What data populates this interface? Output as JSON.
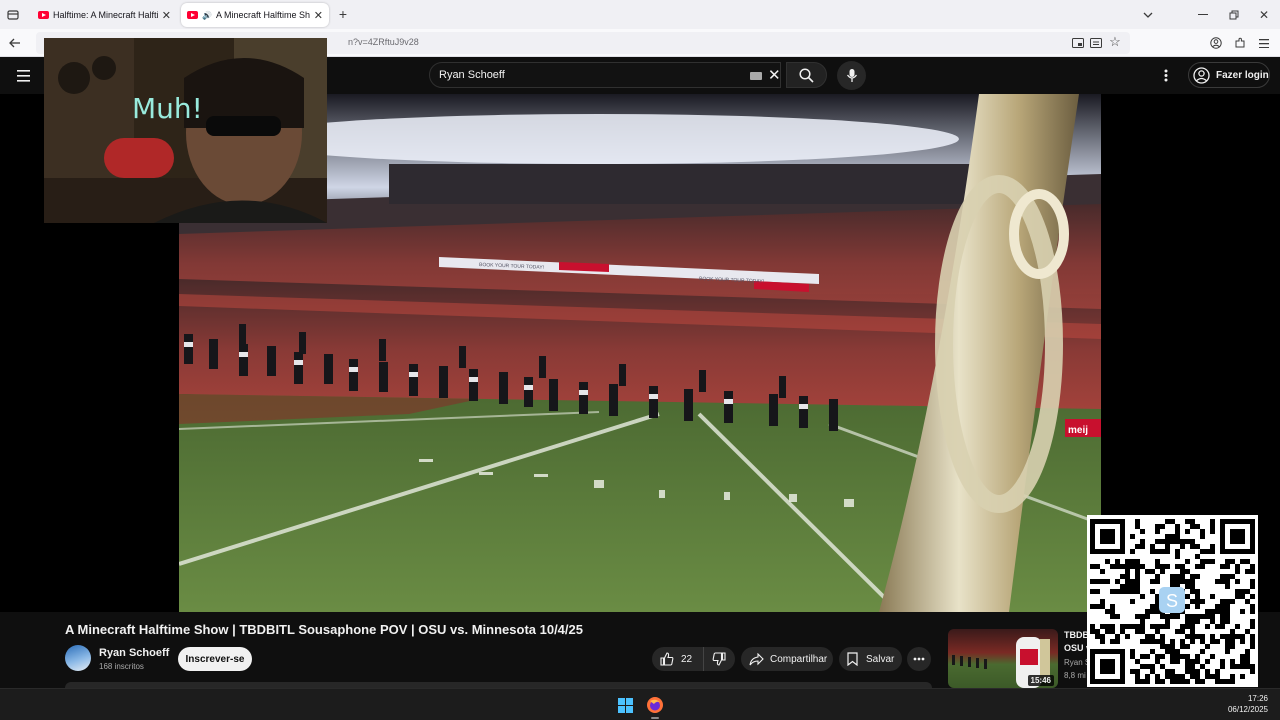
{
  "browser": {
    "tabs": [
      {
        "title": "Halftime: A Minecraft Halftime S",
        "active": false
      },
      {
        "title": "A Minecraft Halftime Show",
        "active": true
      }
    ],
    "url": "n?v=4ZRftuJ9v28"
  },
  "header": {
    "search_query": "Ryan Schoeff",
    "login_label": "Fazer login"
  },
  "video": {
    "title": "A Minecraft Halftime Show | TBDBITL Sousaphone POV | OSU vs. Minnesota 10/4/25",
    "webcam_sign": "Muh!",
    "banner_text_1": "BOOK YOUR TOUR TODAY!",
    "banner_text_2": "BOOK YOUR TOUR TODAY!",
    "ad_corner": "meij"
  },
  "channel": {
    "name": "Ryan Schoeff",
    "subscribers": "168 inscritos",
    "subscribe_label": "Inscrever-se"
  },
  "actions": {
    "likes": "22",
    "share_label": "Compartilhar",
    "save_label": "Salvar"
  },
  "recommendation": {
    "title": "TBDB",
    "title_line2": "OSU v",
    "channel": "Ryan S",
    "meta": "8,8 mi",
    "duration": "15:46"
  },
  "taskbar": {
    "time": "17:26",
    "date": "06/12/2025"
  },
  "colors": {
    "youtube_red": "#ff0033",
    "background": "#0f0f0f"
  }
}
